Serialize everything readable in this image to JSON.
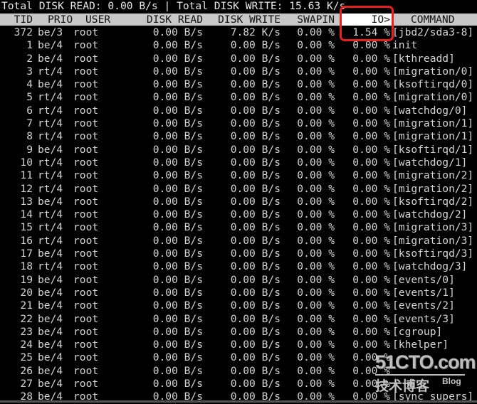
{
  "summary": {
    "total_read_label": "Total DISK READ:",
    "total_read": "0.00 B/s",
    "separator": "|",
    "total_write_label": "Total DISK WRITE:",
    "total_write": "15.63 K/s"
  },
  "columns": {
    "tid": "TID",
    "prio": "PRIO",
    "user": "USER",
    "disk_read": "DISK READ",
    "disk_write": "DISK WRITE",
    "swapin": "SWAPIN",
    "io": "IO>",
    "command": "COMMAND"
  },
  "sort_column": "io",
  "highlight_color": "#e8201c",
  "rows": [
    {
      "tid": "372",
      "prio": "be/3",
      "user": "root",
      "read": "0.00 B/s",
      "write": "7.82 K/s",
      "swapin": "0.00 %",
      "io": "1.54 %",
      "command": "[jbd2/sda3-8]"
    },
    {
      "tid": "1",
      "prio": "be/4",
      "user": "root",
      "read": "0.00 B/s",
      "write": "0.00 B/s",
      "swapin": "0.00 %",
      "io": "0.00 %",
      "command": "init"
    },
    {
      "tid": "2",
      "prio": "be/4",
      "user": "root",
      "read": "0.00 B/s",
      "write": "0.00 B/s",
      "swapin": "0.00 %",
      "io": "0.00 %",
      "command": "[kthreadd]"
    },
    {
      "tid": "3",
      "prio": "rt/4",
      "user": "root",
      "read": "0.00 B/s",
      "write": "0.00 B/s",
      "swapin": "0.00 %",
      "io": "0.00 %",
      "command": "[migration/0]"
    },
    {
      "tid": "4",
      "prio": "be/4",
      "user": "root",
      "read": "0.00 B/s",
      "write": "0.00 B/s",
      "swapin": "0.00 %",
      "io": "0.00 %",
      "command": "[ksoftirqd/0]"
    },
    {
      "tid": "5",
      "prio": "rt/4",
      "user": "root",
      "read": "0.00 B/s",
      "write": "0.00 B/s",
      "swapin": "0.00 %",
      "io": "0.00 %",
      "command": "[migration/0]"
    },
    {
      "tid": "6",
      "prio": "rt/4",
      "user": "root",
      "read": "0.00 B/s",
      "write": "0.00 B/s",
      "swapin": "0.00 %",
      "io": "0.00 %",
      "command": "[watchdog/0]"
    },
    {
      "tid": "7",
      "prio": "rt/4",
      "user": "root",
      "read": "0.00 B/s",
      "write": "0.00 B/s",
      "swapin": "0.00 %",
      "io": "0.00 %",
      "command": "[migration/1]"
    },
    {
      "tid": "8",
      "prio": "rt/4",
      "user": "root",
      "read": "0.00 B/s",
      "write": "0.00 B/s",
      "swapin": "0.00 %",
      "io": "0.00 %",
      "command": "[migration/1]"
    },
    {
      "tid": "9",
      "prio": "be/4",
      "user": "root",
      "read": "0.00 B/s",
      "write": "0.00 B/s",
      "swapin": "0.00 %",
      "io": "0.00 %",
      "command": "[ksoftirqd/1]"
    },
    {
      "tid": "10",
      "prio": "rt/4",
      "user": "root",
      "read": "0.00 B/s",
      "write": "0.00 B/s",
      "swapin": "0.00 %",
      "io": "0.00 %",
      "command": "[watchdog/1]"
    },
    {
      "tid": "11",
      "prio": "rt/4",
      "user": "root",
      "read": "0.00 B/s",
      "write": "0.00 B/s",
      "swapin": "0.00 %",
      "io": "0.00 %",
      "command": "[migration/2]"
    },
    {
      "tid": "12",
      "prio": "rt/4",
      "user": "root",
      "read": "0.00 B/s",
      "write": "0.00 B/s",
      "swapin": "0.00 %",
      "io": "0.00 %",
      "command": "[migration/2]"
    },
    {
      "tid": "13",
      "prio": "be/4",
      "user": "root",
      "read": "0.00 B/s",
      "write": "0.00 B/s",
      "swapin": "0.00 %",
      "io": "0.00 %",
      "command": "[ksoftirqd/2]"
    },
    {
      "tid": "14",
      "prio": "rt/4",
      "user": "root",
      "read": "0.00 B/s",
      "write": "0.00 B/s",
      "swapin": "0.00 %",
      "io": "0.00 %",
      "command": "[watchdog/2]"
    },
    {
      "tid": "15",
      "prio": "rt/4",
      "user": "root",
      "read": "0.00 B/s",
      "write": "0.00 B/s",
      "swapin": "0.00 %",
      "io": "0.00 %",
      "command": "[migration/3]"
    },
    {
      "tid": "16",
      "prio": "rt/4",
      "user": "root",
      "read": "0.00 B/s",
      "write": "0.00 B/s",
      "swapin": "0.00 %",
      "io": "0.00 %",
      "command": "[migration/3]"
    },
    {
      "tid": "17",
      "prio": "be/4",
      "user": "root",
      "read": "0.00 B/s",
      "write": "0.00 B/s",
      "swapin": "0.00 %",
      "io": "0.00 %",
      "command": "[ksoftirqd/3]"
    },
    {
      "tid": "18",
      "prio": "rt/4",
      "user": "root",
      "read": "0.00 B/s",
      "write": "0.00 B/s",
      "swapin": "0.00 %",
      "io": "0.00 %",
      "command": "[watchdog/3]"
    },
    {
      "tid": "19",
      "prio": "be/4",
      "user": "root",
      "read": "0.00 B/s",
      "write": "0.00 B/s",
      "swapin": "0.00 %",
      "io": "0.00 %",
      "command": "[events/0]"
    },
    {
      "tid": "20",
      "prio": "be/4",
      "user": "root",
      "read": "0.00 B/s",
      "write": "0.00 B/s",
      "swapin": "0.00 %",
      "io": "0.00 %",
      "command": "[events/1]"
    },
    {
      "tid": "21",
      "prio": "be/4",
      "user": "root",
      "read": "0.00 B/s",
      "write": "0.00 B/s",
      "swapin": "0.00 %",
      "io": "0.00 %",
      "command": "[events/2]"
    },
    {
      "tid": "22",
      "prio": "be/4",
      "user": "root",
      "read": "0.00 B/s",
      "write": "0.00 B/s",
      "swapin": "0.00 %",
      "io": "0.00 %",
      "command": "[events/3]"
    },
    {
      "tid": "23",
      "prio": "be/4",
      "user": "root",
      "read": "0.00 B/s",
      "write": "0.00 B/s",
      "swapin": "0.00 %",
      "io": "0.00 %",
      "command": "[cgroup]"
    },
    {
      "tid": "24",
      "prio": "be/4",
      "user": "root",
      "read": "0.00 B/s",
      "write": "0.00 B/s",
      "swapin": "0.00 %",
      "io": "0.00 %",
      "command": "[khelper]"
    },
    {
      "tid": "25",
      "prio": "be/4",
      "user": "root",
      "read": "0.00 B/s",
      "write": "0.00 B/s",
      "swapin": "0.00 %",
      "io": "0.00 %",
      "command": ""
    },
    {
      "tid": "26",
      "prio": "be/4",
      "user": "root",
      "read": "0.00 B/s",
      "write": "0.00 B/s",
      "swapin": "0.00 %",
      "io": "0.00 %",
      "command": ""
    },
    {
      "tid": "27",
      "prio": "be/4",
      "user": "root",
      "read": "0.00 B/s",
      "write": "0.00 B/s",
      "swapin": "0.00 %",
      "io": "0.00 %",
      "command": ""
    },
    {
      "tid": "28",
      "prio": "be/4",
      "user": "root",
      "read": "0.00 B/s",
      "write": "0.00 B/s",
      "swapin": "0.00 %",
      "io": "0.00 %",
      "command": "[sync supers]"
    }
  ],
  "watermark": {
    "brand": "51CTO.com",
    "chinese": "技术博客",
    "blog": "Blog"
  }
}
